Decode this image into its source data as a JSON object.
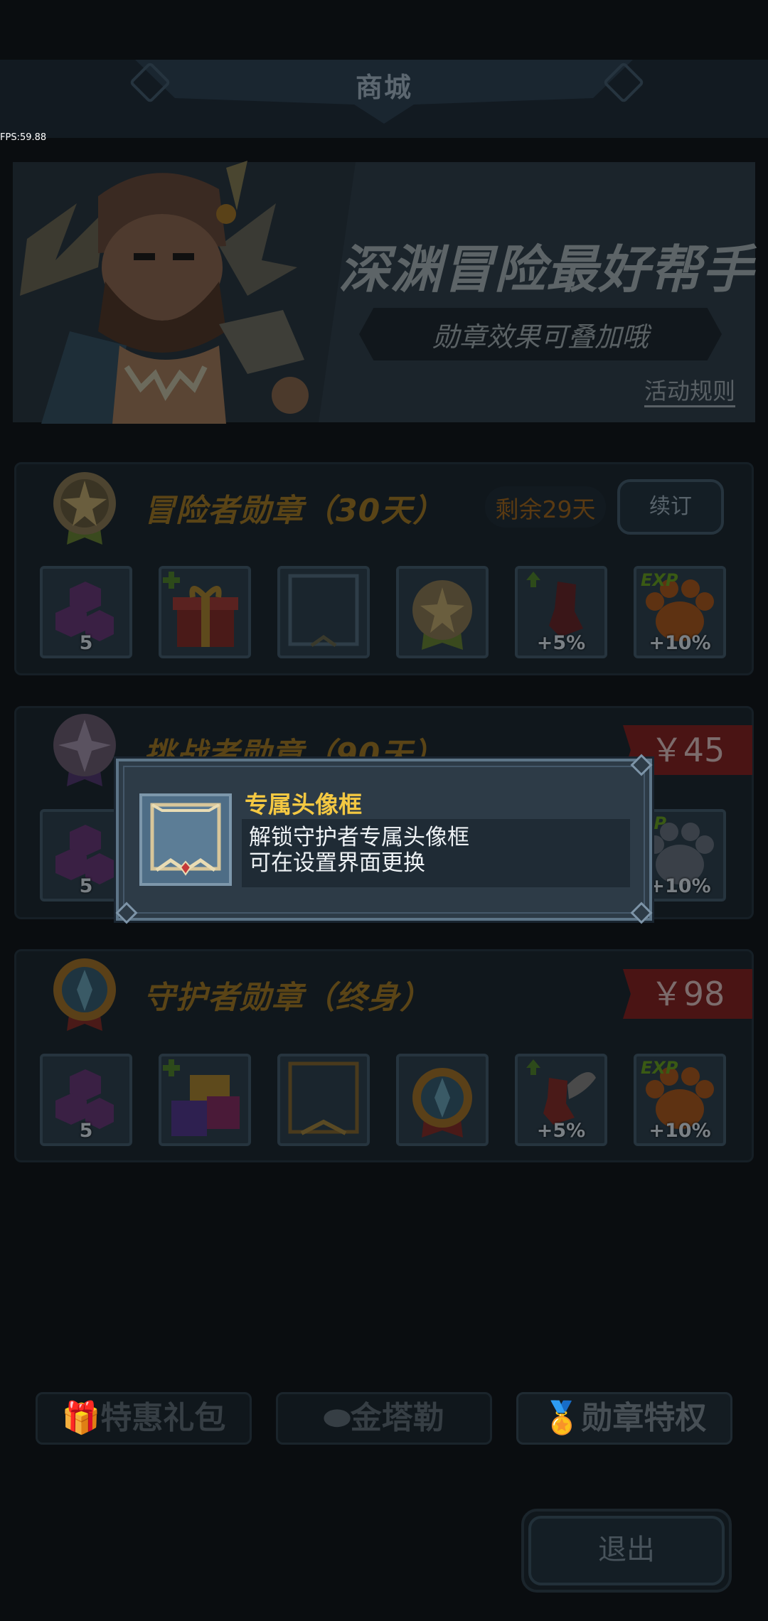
{
  "header": {
    "title": "商城"
  },
  "debug": {
    "fps": "FPS:59.88"
  },
  "banner": {
    "title": "深渊冒险最好帮手",
    "subtitle": "勋章效果可叠加哦",
    "rules_link": "活动规则"
  },
  "panels": [
    {
      "title": "冒险者勋章（30天）",
      "remaining": "剩余29天",
      "renew_label": "续订",
      "rewards": [
        {
          "icon": "gem-cluster-icon",
          "label": "5"
        },
        {
          "icon": "gift-box-icon",
          "label": ""
        },
        {
          "icon": "avatar-frame-icon",
          "label": ""
        },
        {
          "icon": "medal-icon",
          "label": ""
        },
        {
          "icon": "boot-icon",
          "label": "+5%"
        },
        {
          "icon": "paw-exp-icon",
          "label": "+10%",
          "exp": "EXP"
        }
      ]
    },
    {
      "title": "挑战者勋章（90天）",
      "price": "￥45",
      "rewards": [
        {
          "icon": "gem-cluster-icon",
          "label": "5"
        },
        {
          "icon": "paw-exp-icon",
          "label": "+10%",
          "exp": "XP"
        }
      ]
    },
    {
      "title": "守护者勋章（终身）",
      "price": "￥98",
      "rewards": [
        {
          "icon": "gem-cluster-icon",
          "label": "5"
        },
        {
          "icon": "gift-box-icon",
          "label": ""
        },
        {
          "icon": "avatar-frame-icon",
          "label": ""
        },
        {
          "icon": "medal-icon",
          "label": ""
        },
        {
          "icon": "winged-boot-icon",
          "label": "+5%"
        },
        {
          "icon": "paw-exp-icon",
          "label": "+10%",
          "exp": "EXP"
        }
      ]
    }
  ],
  "popup": {
    "title": "专属头像框",
    "desc_line1": "解锁守护者专属头像框",
    "desc_line2": "可在设置界面更换"
  },
  "tabs": [
    {
      "label": "特惠礼包",
      "icon": "gift-icon"
    },
    {
      "label": "金塔勒",
      "icon": "coin-icon"
    },
    {
      "label": "勋章特权",
      "icon": "medal-icon",
      "active": true
    }
  ],
  "exit_label": "退出",
  "colors": {
    "gold": "#f4c842",
    "popup_bg": "#2d3b47",
    "price_red": "#4a1414"
  }
}
